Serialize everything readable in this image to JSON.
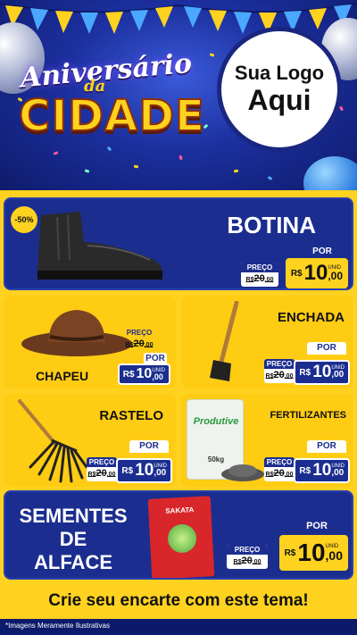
{
  "header": {
    "title_line1": "Aniversário",
    "title_line2": "da",
    "title_line3": "CIDADE",
    "logo_line1": "Sua Logo",
    "logo_line2": "Aqui"
  },
  "products": [
    {
      "name": "BOTINA",
      "discount_badge": "-50%",
      "preco_label": "PREÇO",
      "old_price_prefix": "R$",
      "old_price": "20",
      "old_cents": ",00",
      "por_label": "POR",
      "currency": "R$",
      "new_price": "10",
      "new_cents": ",00",
      "unit": "UNID"
    },
    {
      "name": "CHAPEU",
      "preco_label": "PREÇO",
      "old_price_prefix": "R$",
      "old_price": "20",
      "old_cents": ",00",
      "por_label": "POR",
      "currency": "R$",
      "new_price": "10",
      "new_cents": ",00",
      "unit": "UNID"
    },
    {
      "name": "ENCHADA",
      "preco_label": "PREÇO",
      "old_price_prefix": "R$",
      "old_price": "20",
      "old_cents": ",00",
      "por_label": "POR",
      "currency": "R$",
      "new_price": "10",
      "new_cents": ",00",
      "unit": "UNID"
    },
    {
      "name": "RASTELO",
      "preco_label": "PREÇO",
      "old_price_prefix": "R$",
      "old_price": "20",
      "old_cents": ",00",
      "por_label": "POR",
      "currency": "R$",
      "new_price": "10",
      "new_cents": ",00",
      "unit": "UNID"
    },
    {
      "name": "FERTILIZANTES",
      "package_brand": "Produtive",
      "package_weight": "50kg",
      "preco_label": "PREÇO",
      "old_price_prefix": "R$",
      "old_price": "20",
      "old_cents": ",00",
      "por_label": "POR",
      "currency": "R$",
      "new_price": "10",
      "new_cents": ",00",
      "unit": "UNID"
    },
    {
      "name_line1": "SEMENTES",
      "name_line2": "DE",
      "name_line3": "ALFACE",
      "package_brand": "SAKATA",
      "preco_label": "PREÇO",
      "old_price_prefix": "R$",
      "old_price": "20",
      "old_cents": ",00",
      "por_label": "POR",
      "currency": "R$",
      "new_price": "10",
      "new_cents": ",00",
      "unit": "UNID"
    }
  ],
  "banner": "Crie seu encarte com este tema!",
  "footnote": "*Imagens Meramente Ilustrativas",
  "colors": {
    "brand_blue": "#1b2e8f",
    "brand_yellow": "#ffd21f",
    "header_blue": "#1c2f9e"
  }
}
